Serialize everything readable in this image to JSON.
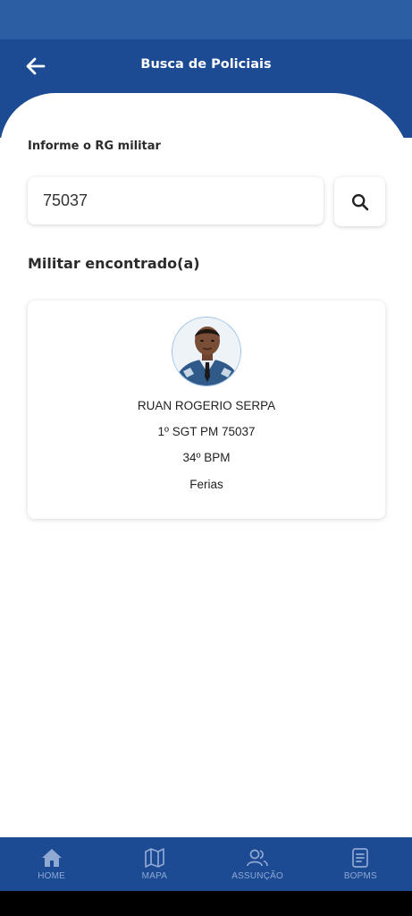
{
  "header": {
    "title": "Busca de Policiais",
    "back_icon": "arrow-left-icon"
  },
  "search": {
    "label": "Informe o RG militar",
    "value": "75037",
    "button_icon": "search-icon"
  },
  "result": {
    "heading": "Militar encontrado(a)",
    "name": "RUAN ROGERIO SERPA",
    "rank_rg": "1º SGT PM 75037",
    "unit": "34º BPM",
    "status": "Ferias"
  },
  "bottom_nav": [
    {
      "label": "HOME",
      "icon": "home-icon"
    },
    {
      "label": "MAPA",
      "icon": "map-icon"
    },
    {
      "label": "ASSUNÇÃO",
      "icon": "users-icon"
    },
    {
      "label": "BOPMS",
      "icon": "document-icon"
    }
  ],
  "colors": {
    "status_bar": "#2b5ea3",
    "header": "#1c4a93",
    "nav_label": "#8fa9d3",
    "text_dark": "#2b2b2b"
  }
}
